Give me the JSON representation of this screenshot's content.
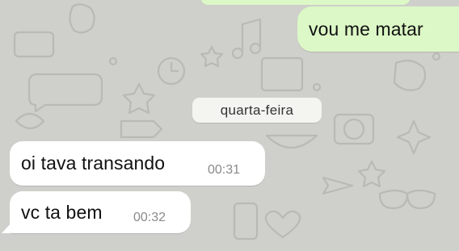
{
  "conversation": {
    "messages": [
      {
        "direction": "outgoing",
        "text": "vou me matar"
      },
      {
        "direction": "incoming",
        "text": "oi tava transando",
        "time": "00:31"
      },
      {
        "direction": "incoming",
        "text": "vc ta bem",
        "time": "00:32"
      }
    ],
    "date_separator": "quarta-feira"
  },
  "colors": {
    "outgoing_bubble": "#dcf8c6",
    "incoming_bubble": "#ffffff",
    "background": "#cfcfcb",
    "timestamp": "#8a8a8a"
  }
}
